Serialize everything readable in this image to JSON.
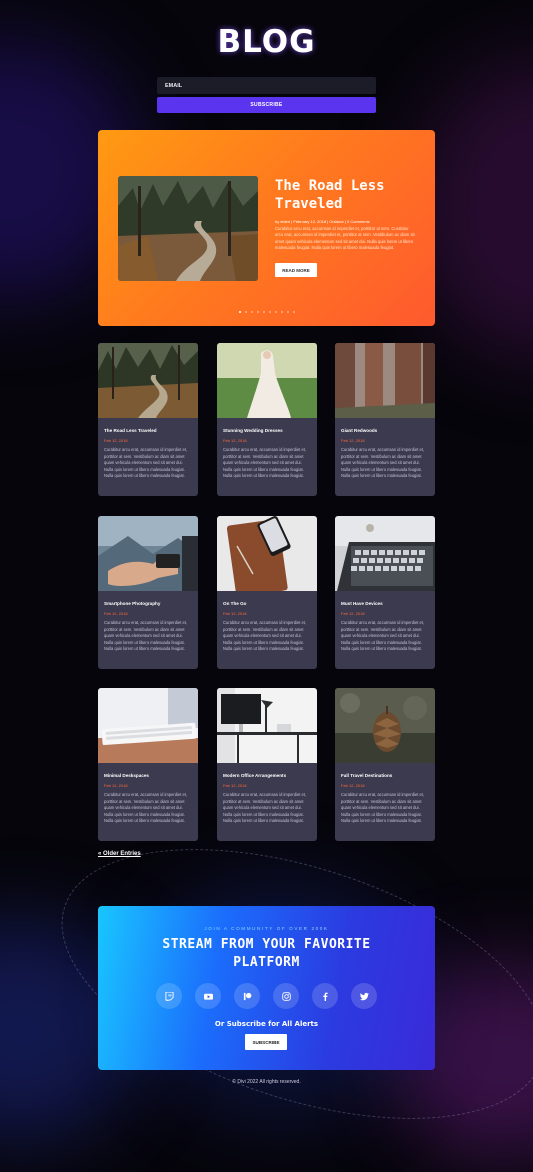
{
  "page": {
    "title": "BLOG"
  },
  "subscribe": {
    "email_placeholder": "EMAIL",
    "button": "SUBSCRIBE"
  },
  "hero": {
    "title": "The Road Less Traveled",
    "meta": "by elden | February 12, 2018 | Outdoor | 0 Comments",
    "excerpt": "Curabitur arcu erat, accumsan id imperdiet et, porttitor at sem. Curabitur arcu erat, accumsan id imperdiet et, porttitor at sem. Vestibulum ac diam sit amet quam vehicula elementum sed sit amet dui. Nulla quis lorem ut libero malesuada feugiat. Nulla quis lorem ut libero malesuada feugiat.",
    "button": "READ MORE",
    "slides": 10,
    "active_slide": 0
  },
  "posts": [
    {
      "title": "The Road Less Traveled",
      "date": "Feb 12, 2018",
      "excerpt": "Curabitur arcu erat, accumsan id imperdiet et, porttitor at sem. Vestibulum ac diam sit amet quam vehicula elementum sed sit amet dui. Nulla quis lorem ut libero malesuada feugiat. Nulla quis lorem ut libero malesuada feugiat.",
      "image": "forest-road"
    },
    {
      "title": "Stunning Wedding Dresses",
      "date": "Feb 12, 2018",
      "excerpt": "Curabitur arcu erat, accumsan id imperdiet et, porttitor at sem. Vestibulum ac diam sit amet quam vehicula elementum sed sit amet dui. Nulla quis lorem ut libero malesuada feugiat. Nulla quis lorem ut libero malesuada feugiat.",
      "image": "wedding-dress"
    },
    {
      "title": "Giant Redwoods",
      "date": "Feb 12, 2018",
      "excerpt": "Curabitur arcu erat, accumsan id imperdiet et, porttitor at sem. Vestibulum ac diam sit amet quam vehicula elementum sed sit amet dui. Nulla quis lorem ut libero malesuada feugiat. Nulla quis lorem ut libero malesuada feugiat.",
      "image": "redwoods"
    },
    {
      "title": "Smartphone Photography",
      "date": "Feb 12, 2018",
      "excerpt": "Curabitur arcu erat, accumsan id imperdiet et, porttitor at sem. Vestibulum ac diam sit amet quam vehicula elementum sed sit amet dui. Nulla quis lorem ut libero malesuada feugiat. Nulla quis lorem ut libero malesuada feugiat.",
      "image": "smartphone-photo"
    },
    {
      "title": "On The Go",
      "date": "Feb 12, 2018",
      "excerpt": "Curabitur arcu erat, accumsan id imperdiet et, porttitor at sem. Vestibulum ac diam sit amet quam vehicula elementum sed sit amet dui. Nulla quis lorem ut libero malesuada feugiat. Nulla quis lorem ut libero malesuada feugiat.",
      "image": "phone-notebook"
    },
    {
      "title": "Must Have Devices",
      "date": "Feb 12, 2018",
      "excerpt": "Curabitur arcu erat, accumsan id imperdiet et, porttitor at sem. Vestibulum ac diam sit amet quam vehicula elementum sed sit amet dui. Nulla quis lorem ut libero malesuada feugiat. Nulla quis lorem ut libero malesuada feugiat.",
      "image": "laptop"
    },
    {
      "title": "Minimal Deskspaces",
      "date": "Feb 12, 2018",
      "excerpt": "Curabitur arcu erat, accumsan id imperdiet et, porttitor at sem. Vestibulum ac diam sit amet quam vehicula elementum sed sit amet dui. Nulla quis lorem ut libero malesuada feugiat. Nulla quis lorem ut libero malesuada feugiat.",
      "image": "keyboard"
    },
    {
      "title": "Modern Office Arrangements",
      "date": "Feb 12, 2018",
      "excerpt": "Curabitur arcu erat, accumsan id imperdiet et, porttitor at sem. Vestibulum ac diam sit amet quam vehicula elementum sed sit amet dui. Nulla quis lorem ut libero malesuada feugiat. Nulla quis lorem ut libero malesuada feugiat.",
      "image": "office-desk"
    },
    {
      "title": "Fall Travel Destinations",
      "date": "Feb 12, 2018",
      "excerpt": "Curabitur arcu erat, accumsan id imperdiet et, porttitor at sem. Vestibulum ac diam sit amet quam vehicula elementum sed sit amet dui. Nulla quis lorem ut libero malesuada feugiat. Nulla quis lorem ut libero malesuada feugiat.",
      "image": "pinecone"
    }
  ],
  "pagination": {
    "older": "« Older Entries"
  },
  "cta": {
    "kicker": "JOIN A COMMUNITY OF OVER 200K",
    "heading_line1": "STREAM FROM YOUR FAVORITE",
    "heading_line2": "PLATFORM",
    "socials": [
      {
        "name": "twitch-icon"
      },
      {
        "name": "youtube-icon"
      },
      {
        "name": "patreon-icon"
      },
      {
        "name": "instagram-icon"
      },
      {
        "name": "facebook-icon"
      },
      {
        "name": "twitter-icon"
      }
    ],
    "subscribe_text": "Or Subscribe for All Alerts",
    "button": "SUBSCRIBE"
  },
  "footer": {
    "copyright": "© Divi 2022 All rights reserved."
  },
  "colors": {
    "accent": "#5b34f0",
    "date": "#ff6a3a",
    "card": "#3b3a4f",
    "hero_start": "#ff9a12",
    "hero_end": "#ff5a2e",
    "cta_start": "#19c6ff",
    "cta_end": "#3a2ad8"
  }
}
